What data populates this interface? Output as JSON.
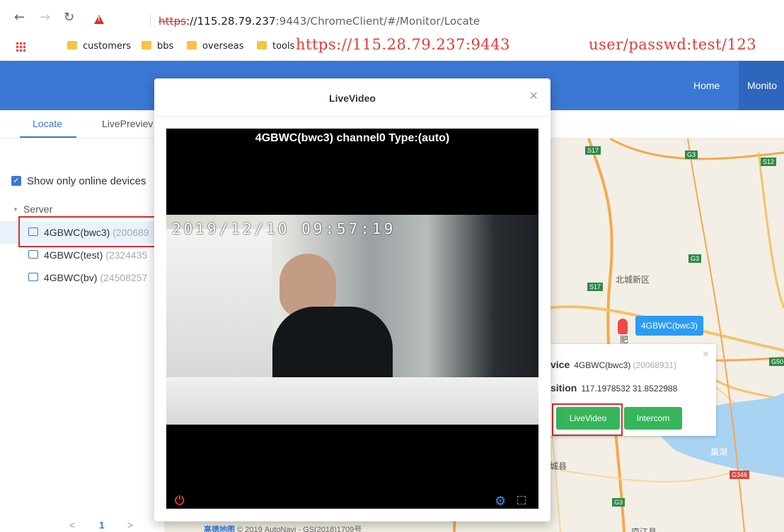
{
  "browser": {
    "url_proto": "https",
    "url_host": "://115.28.79.237",
    "url_path": ":9443/ChromeClient/#/Monitor/Locate",
    "bookmarks": [
      "customers",
      "bbs",
      "overseas",
      "tools"
    ],
    "overlay_url": "https://115.28.79.237:9443",
    "overlay_creds": "user/passwd:test/123"
  },
  "header": {
    "nav": [
      "Home",
      "Monito"
    ]
  },
  "tabs": [
    "Locate",
    "LivePreviev"
  ],
  "left": {
    "show_online_label": "Show only online devices",
    "server_label": "Server",
    "devices": [
      {
        "name": "4GBWC(bwc3)",
        "id": "(200689"
      },
      {
        "name": "4GBWC(test)",
        "id": "(2324435"
      },
      {
        "name": "4GBWC(bv)",
        "id": "(24508257"
      }
    ],
    "pager": {
      "prev": "<",
      "page": "1",
      "next": ">"
    }
  },
  "map": {
    "labels": {
      "district": "北城新区",
      "lake": "巢湖",
      "county1": "肥",
      "county2": "城县",
      "county3": "庐江县",
      "attrib": "© 2019 AutoNavi - GS(2018)1709号",
      "brand": "高德地图"
    },
    "shields": [
      "S17",
      "G3",
      "S12",
      "S17",
      "G3",
      "G3",
      "G50",
      "G346",
      "G3"
    ],
    "marker_label": "4GBWC(bwc3)",
    "popup": {
      "device_label": "vice",
      "device_value": "4GBWC(bwc3)",
      "device_id": "(20068931)",
      "position_label": "sition",
      "position_value": "117.1978532   31.8522988",
      "live_btn": "LiveVideo",
      "intercom_btn": "Intercom"
    }
  },
  "modal": {
    "title": "LiveVideo",
    "video_title": "4GBWC(bwc3) channel0  Type:(auto)",
    "timestamp": "2019/12/10 09:57:19"
  }
}
